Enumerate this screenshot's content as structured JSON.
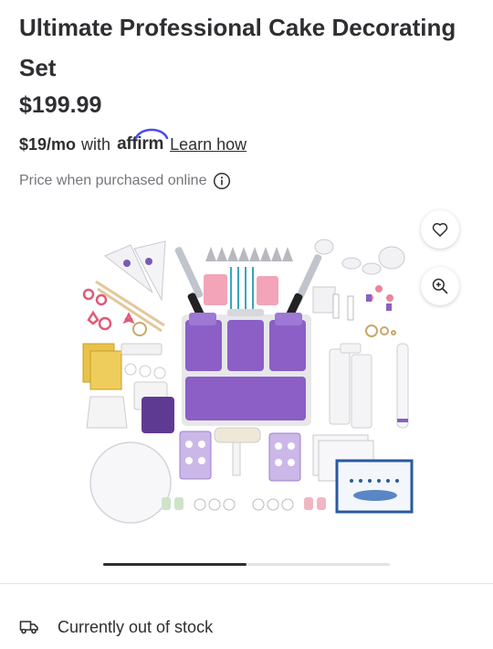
{
  "product": {
    "title": "Ultimate Professional Cake Decorating Set",
    "price": "$199.99",
    "monthly": "$19/mo",
    "with_text": "with",
    "affirm_brand": "affirm",
    "learn_how": "Learn how",
    "price_note": "Price when purchased online"
  },
  "gallery": {
    "image_alt": "Cake decorating set with purple caddy, piping tips, spatulas, cutters and turntable",
    "progress": 0.5
  },
  "stock": {
    "status": "Currently out of stock"
  },
  "colors": {
    "text": "#2e2f32",
    "muted": "#74767c",
    "purple": "#8b5fc6",
    "affirm_blue": "#4a4af4"
  },
  "icons": [
    "heart-icon",
    "zoom-in-icon",
    "info-icon",
    "truck-icon"
  ]
}
